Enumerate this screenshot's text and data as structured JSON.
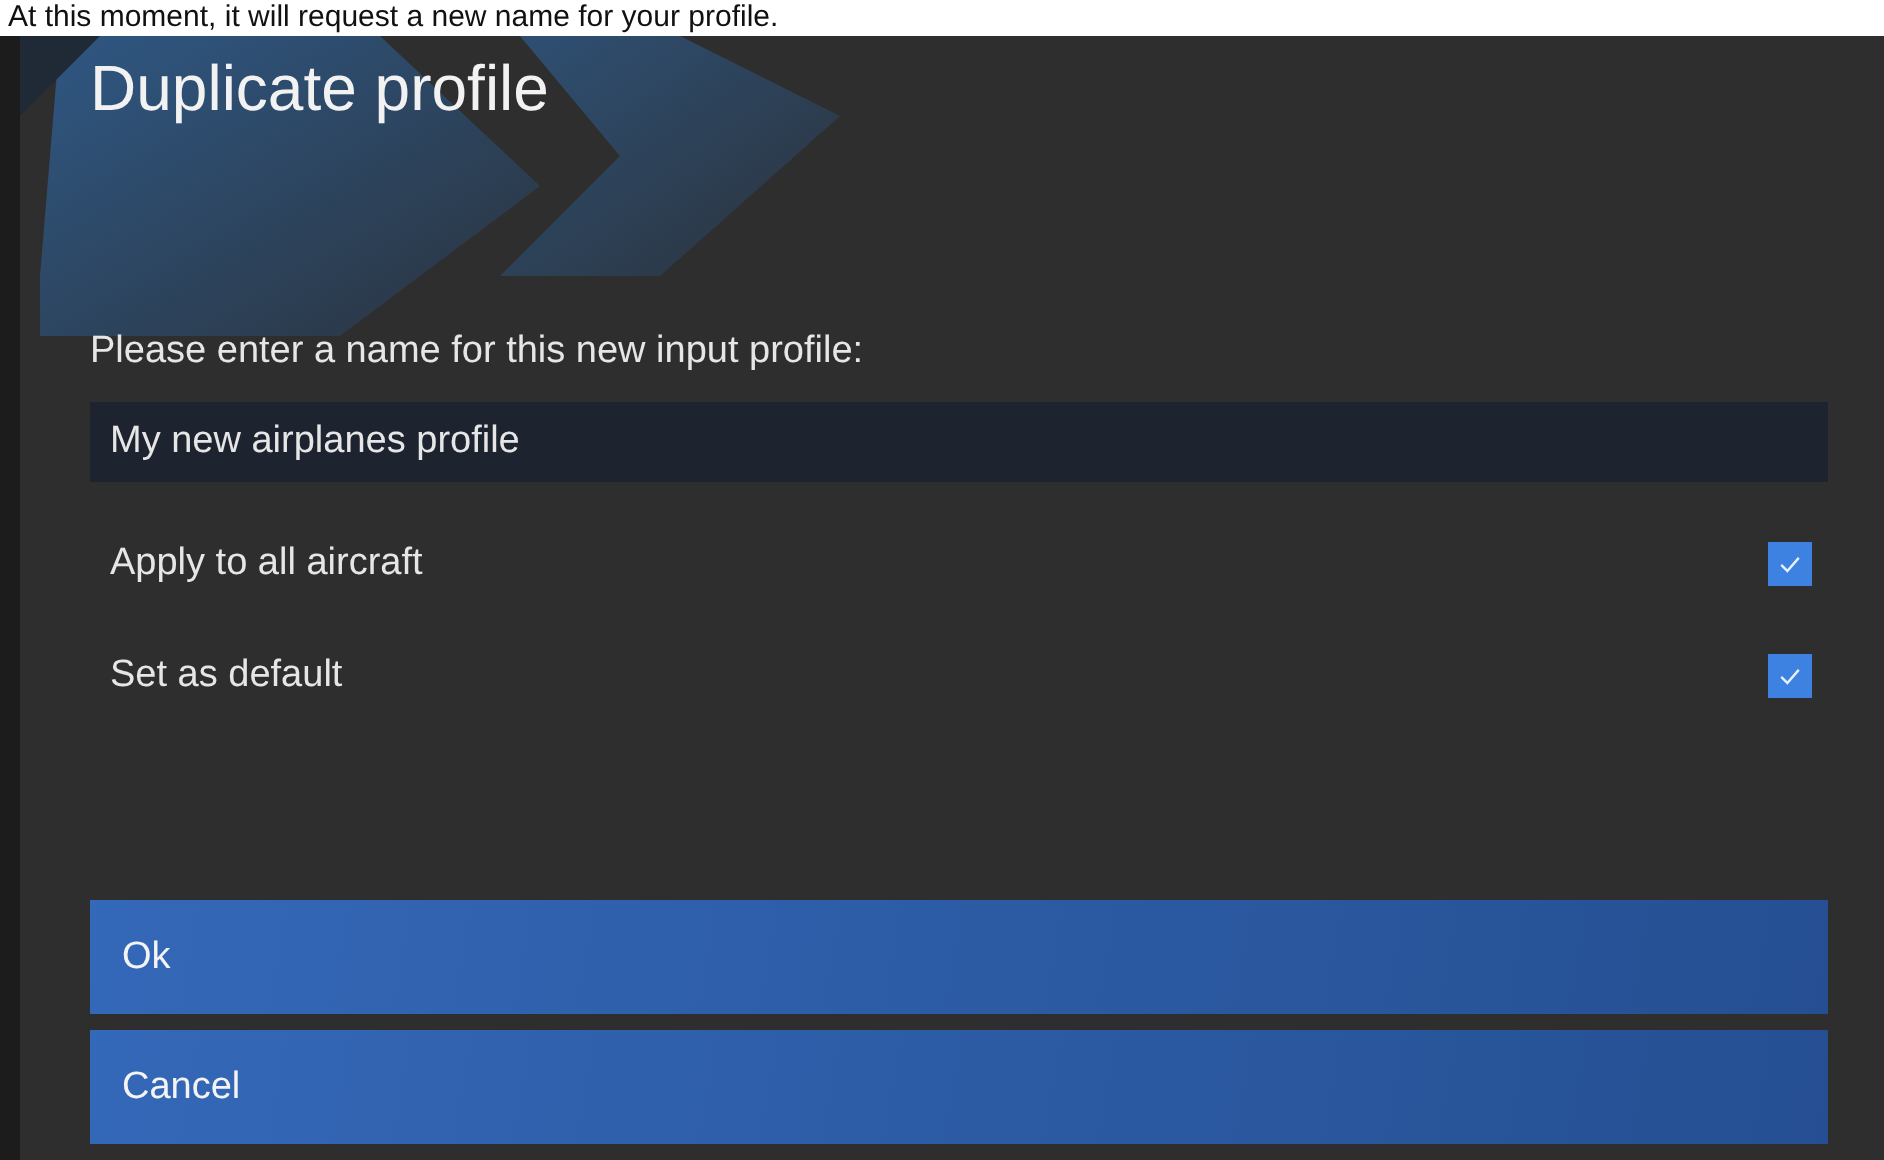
{
  "caption": "At this moment, it will request a new name for your profile.",
  "dialog": {
    "title": "Duplicate profile",
    "prompt": "Please enter a name for this new input profile:",
    "name_field": {
      "value": "My new airplanes profile"
    },
    "options": [
      {
        "label": "Apply to all aircraft",
        "checked": true
      },
      {
        "label": "Set as default",
        "checked": true
      }
    ],
    "buttons": [
      "Ok",
      "Cancel"
    ]
  }
}
